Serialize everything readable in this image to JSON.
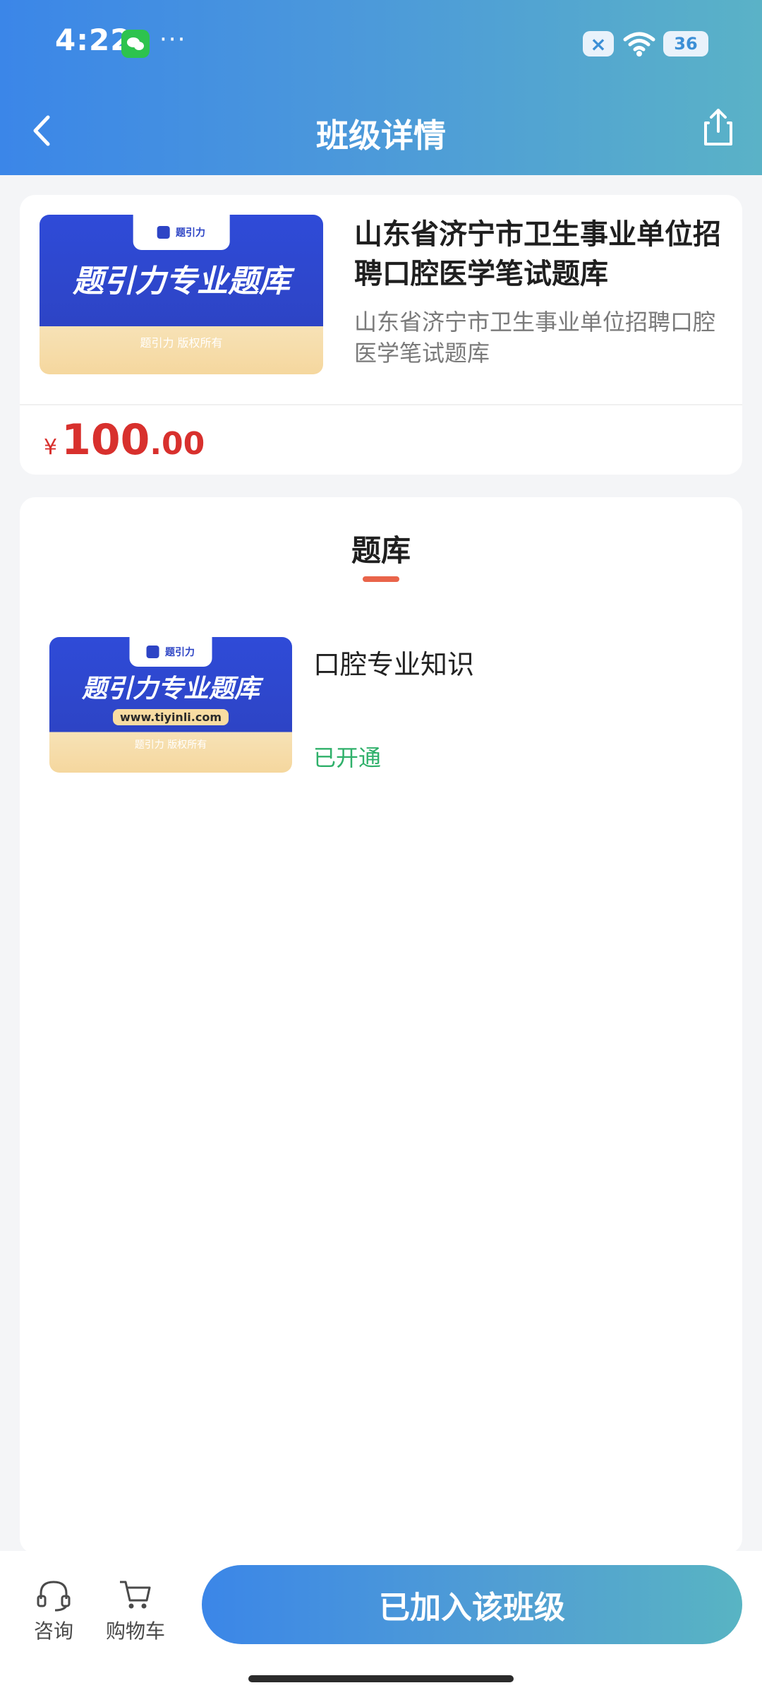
{
  "status": {
    "time": "4:22",
    "dots": "···",
    "close_icon_text": "×",
    "battery_text": "36"
  },
  "nav": {
    "title": "班级详情"
  },
  "product": {
    "title": "山东省济宁市卫生事业单位招聘口腔医学笔试题库",
    "subtitle": "山东省济宁市卫生事业单位招聘口腔医学笔试题库",
    "price_currency": "¥",
    "price_int": "100",
    "price_dec": ".00",
    "thumb_headline": "题引力专业题库",
    "thumb_copyright": "题引力 版权所有",
    "thumb_brand": "题引力"
  },
  "bank": {
    "section_title": "题库",
    "items": [
      {
        "name": "口腔专业知识",
        "status": "已开通",
        "thumb_headline": "题引力专业题库",
        "thumb_url": "www.tiyinli.com",
        "thumb_copyright": "题引力 版权所有",
        "thumb_brand": "题引力"
      }
    ]
  },
  "bottom": {
    "consult_label": "咨询",
    "cart_label": "购物车",
    "join_label": "已加入该班级"
  },
  "colors": {
    "accent": "#3b86e8",
    "price": "#d8302d",
    "opened": "#2fb06a",
    "indicator": "#e9644a"
  }
}
